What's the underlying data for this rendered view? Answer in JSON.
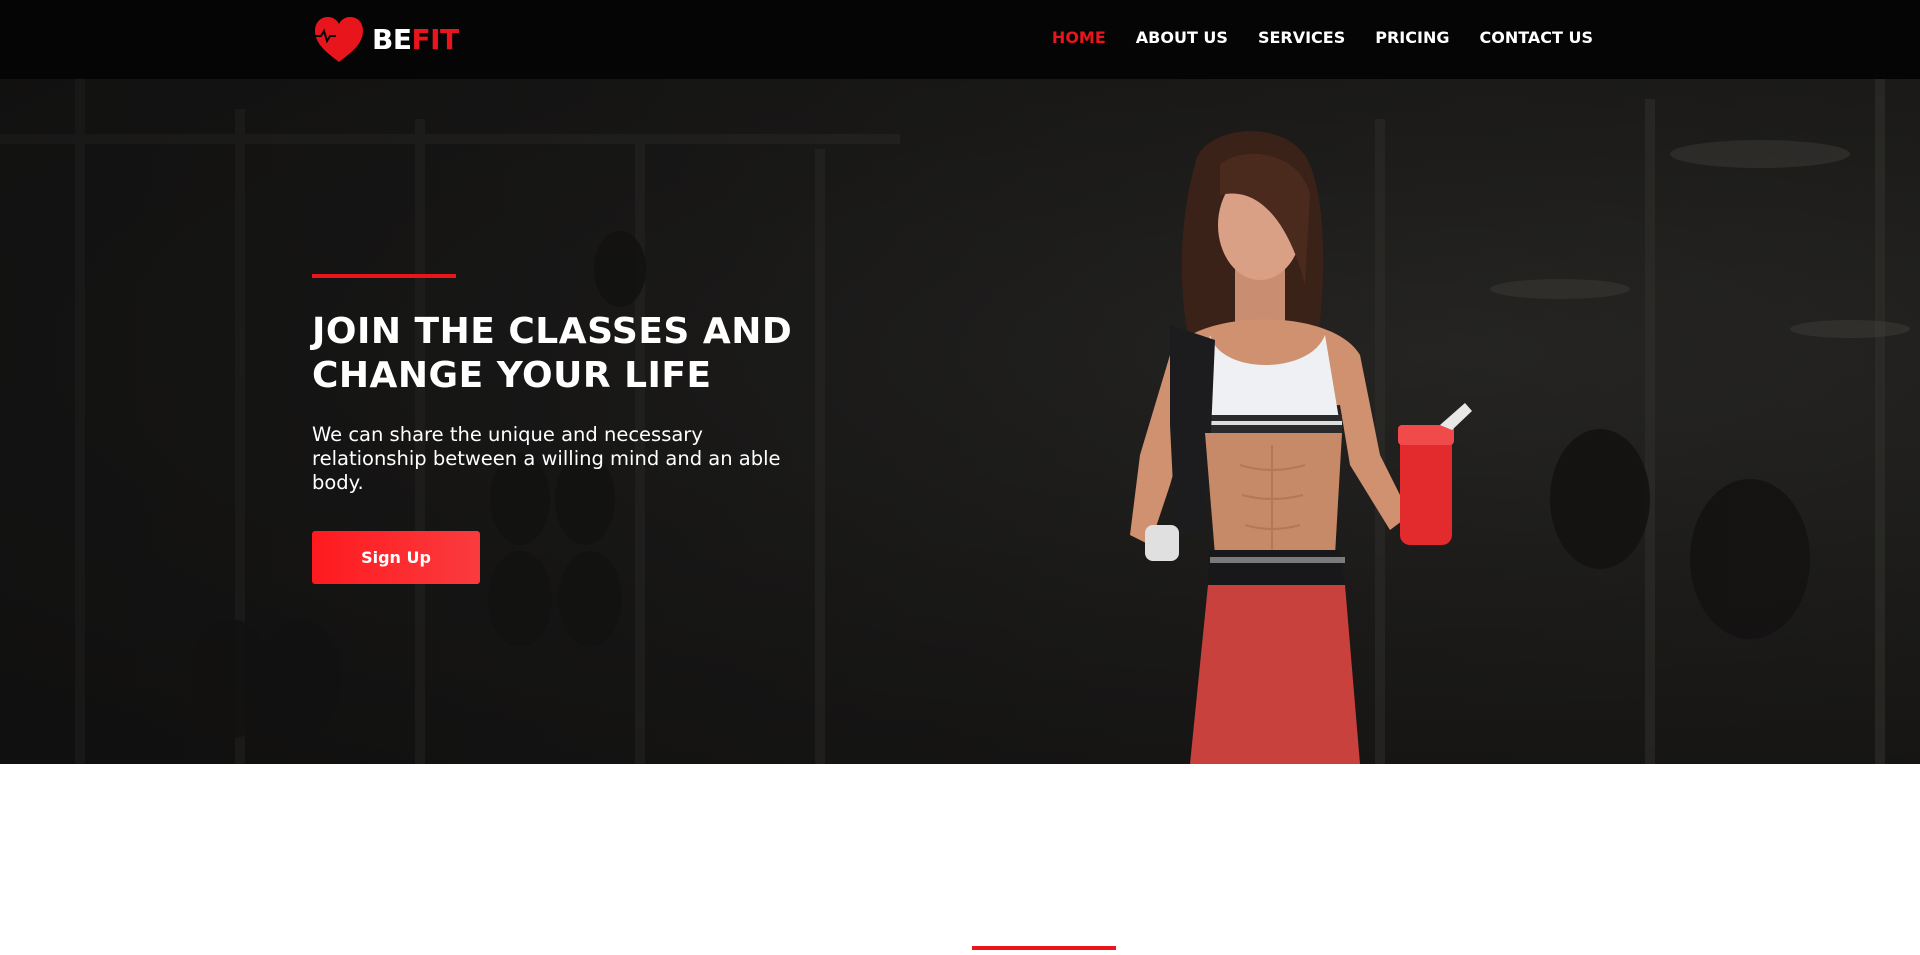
{
  "brand": {
    "name_part1": "BE",
    "name_part2": "FIT",
    "accent_color": "#e8161c",
    "logo_icon": "heart-icon"
  },
  "nav": {
    "items": [
      {
        "label": "HOME",
        "active": true
      },
      {
        "label": "ABOUT US",
        "active": false
      },
      {
        "label": "SERVICES",
        "active": false
      },
      {
        "label": "PRICING",
        "active": false
      },
      {
        "label": "CONTACT US",
        "active": false
      }
    ]
  },
  "hero": {
    "title": "JOIN THE CLASSES AND CHANGE YOUR LIFE",
    "subtitle": "We can share the unique and necessary relationship between a willing mind and an able body.",
    "cta_label": "Sign Up"
  },
  "colors": {
    "header_bg": "#050505",
    "hero_bg": "#1f1e1c",
    "button": "#ff1a1f"
  }
}
